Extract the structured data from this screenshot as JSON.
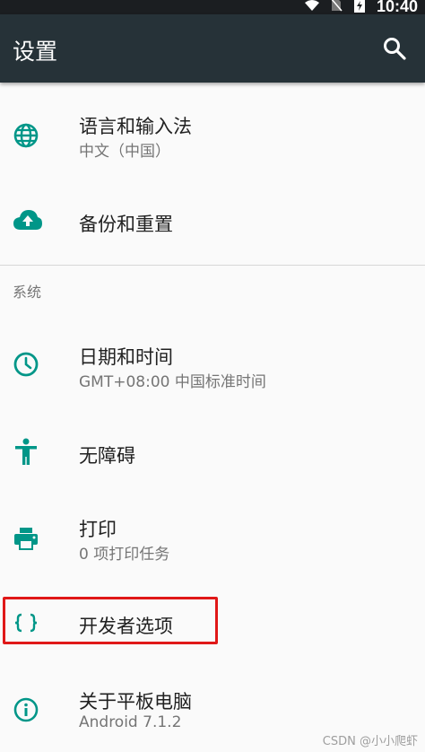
{
  "status_bar": {
    "time": "10:40"
  },
  "app_bar": {
    "title": "设置"
  },
  "items_top": [
    {
      "title": "语言和输入法",
      "subtitle": "中文（中国）",
      "icon": "globe-icon"
    },
    {
      "title": "备份和重置",
      "subtitle": "",
      "icon": "cloud-upload-icon"
    }
  ],
  "section_system": {
    "label": "系统"
  },
  "items_system": [
    {
      "title": "日期和时间",
      "subtitle": "GMT+08:00 中国标准时间",
      "icon": "clock-icon"
    },
    {
      "title": "无障碍",
      "subtitle": "",
      "icon": "accessibility-icon"
    },
    {
      "title": "打印",
      "subtitle": "0 项打印任务",
      "icon": "printer-icon"
    },
    {
      "title": "开发者选项",
      "subtitle": "",
      "icon": "code-braces-icon"
    },
    {
      "title": "关于平板电脑",
      "subtitle": "Android 7.1.2",
      "icon": "info-icon"
    }
  ],
  "colors": {
    "icon_teal": "#009688",
    "appbar": "#263238",
    "highlight": "#e01818"
  },
  "watermark": "CSDN @小小爬虾"
}
